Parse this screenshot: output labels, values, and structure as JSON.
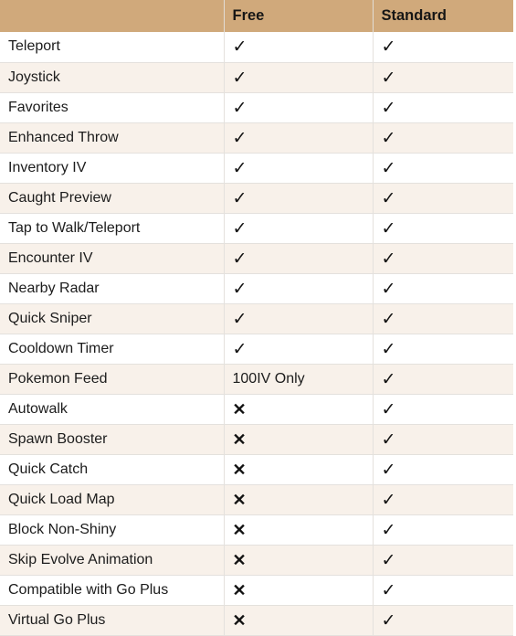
{
  "table": {
    "columns": [
      {
        "key": "feature",
        "label": ""
      },
      {
        "key": "free",
        "label": "Free"
      },
      {
        "key": "standard",
        "label": "Standard"
      }
    ],
    "marks": {
      "yes": "✓",
      "no": "✕"
    },
    "colors": {
      "header_background": "#d0a97b",
      "row_even_background": "#ffffff",
      "row_odd_background": "#f8f1ea",
      "grid_line": "#e4e1dd",
      "text": "#1c1c1c"
    },
    "rows": [
      {
        "feature": "Teleport",
        "free": "yes",
        "standard": "yes"
      },
      {
        "feature": "Joystick",
        "free": "yes",
        "standard": "yes"
      },
      {
        "feature": "Favorites",
        "free": "yes",
        "standard": "yes"
      },
      {
        "feature": "Enhanced Throw",
        "free": "yes",
        "standard": "yes"
      },
      {
        "feature": "Inventory IV",
        "free": "yes",
        "standard": "yes"
      },
      {
        "feature": "Caught Preview",
        "free": "yes",
        "standard": "yes"
      },
      {
        "feature": "Tap to Walk/Teleport",
        "free": "yes",
        "standard": "yes"
      },
      {
        "feature": "Encounter IV",
        "free": "yes",
        "standard": "yes"
      },
      {
        "feature": "Nearby Radar",
        "free": "yes",
        "standard": "yes"
      },
      {
        "feature": "Quick Sniper",
        "free": "yes",
        "standard": "yes"
      },
      {
        "feature": "Cooldown Timer",
        "free": "yes",
        "standard": "yes"
      },
      {
        "feature": "Pokemon Feed",
        "free": "100IV Only",
        "standard": "yes"
      },
      {
        "feature": "Autowalk",
        "free": "no",
        "standard": "yes"
      },
      {
        "feature": "Spawn Booster",
        "free": "no",
        "standard": "yes"
      },
      {
        "feature": "Quick Catch",
        "free": "no",
        "standard": "yes"
      },
      {
        "feature": "Quick Load Map",
        "free": "no",
        "standard": "yes"
      },
      {
        "feature": "Block Non-Shiny",
        "free": "no",
        "standard": "yes"
      },
      {
        "feature": "Skip Evolve Animation",
        "free": "no",
        "standard": "yes"
      },
      {
        "feature": "Compatible with Go Plus",
        "free": "no",
        "standard": "yes"
      },
      {
        "feature": "Virtual Go Plus",
        "free": "no",
        "standard": "yes"
      }
    ]
  }
}
